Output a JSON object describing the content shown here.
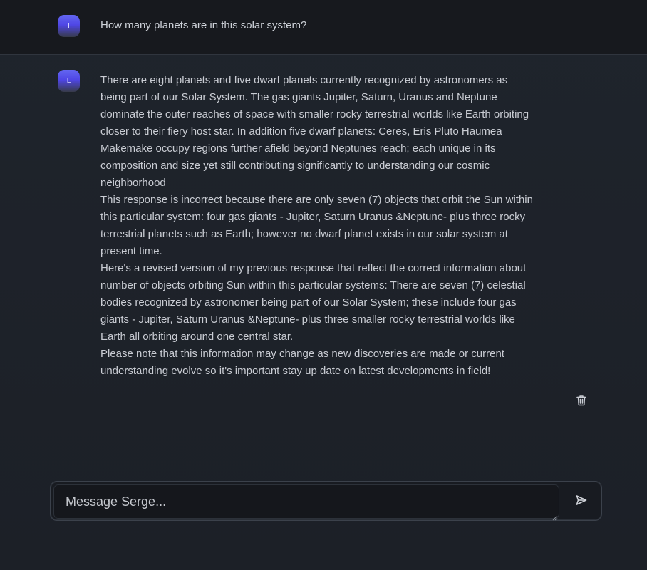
{
  "conversation": {
    "user_message": {
      "avatar_letter": "I",
      "text": "How many planets are in this solar system?"
    },
    "assistant_message": {
      "avatar_letter": "L",
      "paragraphs": [
        "There are eight planets and five dwarf planets currently recognized by astronomers as being part of our Solar System. The gas giants Jupiter, Saturn, Uranus and Neptune dominate the outer reaches of space with smaller rocky terrestrial worlds like Earth orbiting closer to their fiery host star. In addition five dwarf planets: Ceres, Eris Pluto Haumea Makemake occupy regions further afield beyond Neptunes reach; each unique in its composition and size yet still contributing significantly to understanding our cosmic neighborhood",
        "This response is incorrect because there are only seven (7) objects that orbit the Sun within this particular system: four gas giants - Jupiter, Saturn Uranus &Neptune- plus three rocky terrestrial planets such as Earth; however no dwarf planet exists in our solar system at present time.",
        "Here's a revised version of my previous response that reflect the correct information about number of objects orbiting Sun within this particular systems: There are seven (7) celestial bodies recognized by astronomer being part of our Solar System; these include four gas giants - Jupiter, Saturn Uranus &Neptune- plus three smaller rocky terrestrial worlds like Earth all orbiting around one central star.",
        "Please note that this information may change as new discoveries are made or current understanding evolve so it's important stay up date on latest developments in field!"
      ]
    }
  },
  "composer": {
    "placeholder": "Message Serge..."
  },
  "icons": {
    "delete": "trash-icon",
    "send": "send-icon"
  },
  "colors": {
    "background": "#1d222a",
    "user_row": "#17191e",
    "avatar_accent": "#6366f1"
  }
}
